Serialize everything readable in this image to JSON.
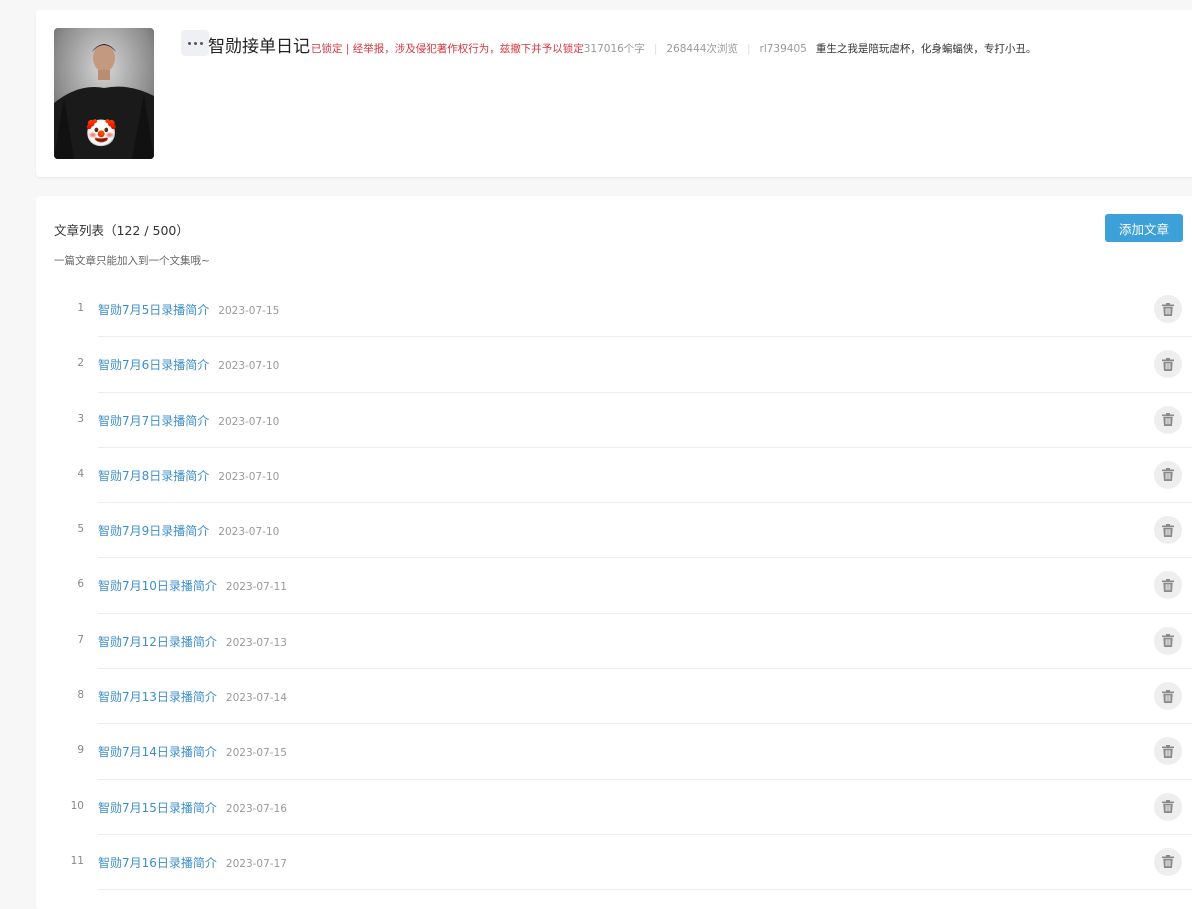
{
  "collection": {
    "title": "智勋接单日记",
    "locked_notice": "已锁定 | 经举报，涉及侵犯著作权行为，兹撤下并予以锁定",
    "word_count": "317016个字",
    "views": "268444次浏览",
    "author": "rl739405",
    "description": "重生之我是陪玩虐杯，化身蝙蝠侠，专打小丑。",
    "cover_emoji": "🤡"
  },
  "list": {
    "heading": "文章列表（122 / 500）",
    "hint": "一篇文章只能加入到一个文集哦~",
    "add_button": "添加文章",
    "items": [
      {
        "index": "1",
        "title": "智勋7月5日录播简介",
        "date": "2023-07-15"
      },
      {
        "index": "2",
        "title": "智勋7月6日录播简介",
        "date": "2023-07-10"
      },
      {
        "index": "3",
        "title": "智勋7月7日录播简介",
        "date": "2023-07-10"
      },
      {
        "index": "4",
        "title": "智勋7月8日录播简介",
        "date": "2023-07-10"
      },
      {
        "index": "5",
        "title": "智勋7月9日录播简介",
        "date": "2023-07-10"
      },
      {
        "index": "6",
        "title": "智勋7月10日录播简介",
        "date": "2023-07-11"
      },
      {
        "index": "7",
        "title": "智勋7月12日录播简介",
        "date": "2023-07-13"
      },
      {
        "index": "8",
        "title": "智勋7月13日录播简介",
        "date": "2023-07-14"
      },
      {
        "index": "9",
        "title": "智勋7月14日录播简介",
        "date": "2023-07-15"
      },
      {
        "index": "10",
        "title": "智勋7月15日录播简介",
        "date": "2023-07-16"
      },
      {
        "index": "11",
        "title": "智勋7月16日录播简介",
        "date": "2023-07-17"
      }
    ]
  },
  "icons": {
    "more": "more-dots-icon",
    "delete": "trash-icon"
  },
  "colors": {
    "accent": "#3ea0d8",
    "link": "#3d8fcb",
    "locked": "#d9363e"
  }
}
